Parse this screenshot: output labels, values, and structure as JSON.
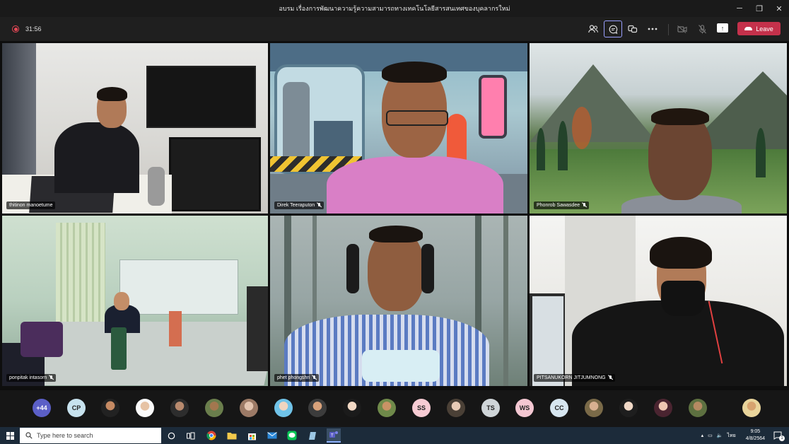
{
  "window": {
    "title": "อบรม เรื่องการพัฒนาความรู้ความสามารถทางเทคโนโลยีสารสนเทศของบุคลากรใหม่",
    "minimize": "─",
    "restore": "❐",
    "close": "✕"
  },
  "toolbar": {
    "timer": "31:56",
    "leave_label": "Leave",
    "icons": [
      "participants-icon",
      "chat-icon",
      "reactions-icon",
      "more-icon",
      "camera-off-icon",
      "mic-off-icon",
      "share-icon"
    ]
  },
  "participants": [
    {
      "name": "thitinon manoetume",
      "muted": false
    },
    {
      "name": "Direk Teeraputon",
      "muted": true
    },
    {
      "name": "Phonrob Sawasdee",
      "muted": true
    },
    {
      "name": "ponpitak intasorn",
      "muted": true
    },
    {
      "name": "phet phongshri",
      "muted": true
    },
    {
      "name": "PITSANUKORN JITJUMNONG",
      "muted": true
    }
  ],
  "strip": {
    "more_count": "+44",
    "initials": [
      "CP",
      "SS",
      "TS",
      "WS",
      "CC"
    ]
  },
  "taskbar": {
    "search_placeholder": "Type here to search",
    "language": "ไทย",
    "time": "9:05",
    "date": "4/8/2564",
    "notification_count": "1"
  },
  "colors": {
    "accent": "#5b5fc7",
    "leave": "#c4314b",
    "recording": "#e74856"
  }
}
